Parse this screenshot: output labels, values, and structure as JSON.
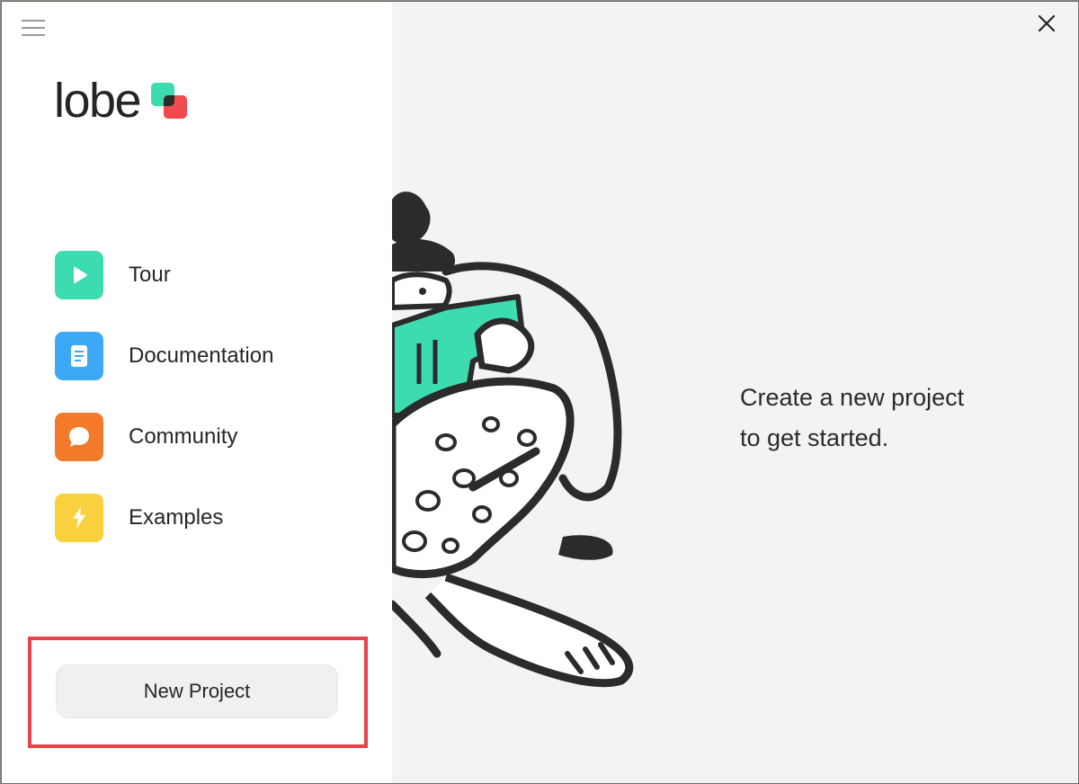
{
  "app": {
    "name": "lobe",
    "brand_colors": {
      "green": "#3ddbb0",
      "red": "#ef4b4f",
      "overlap": "#2b2b2b"
    }
  },
  "sidebar": {
    "menu_icon": "hamburger-icon",
    "items": [
      {
        "label": "Tour",
        "icon": "play-icon",
        "color": "#3ddbb0"
      },
      {
        "label": "Documentation",
        "icon": "document-icon",
        "color": "#3da8f5"
      },
      {
        "label": "Community",
        "icon": "chat-bubble-icon",
        "color": "#f37a2a"
      },
      {
        "label": "Examples",
        "icon": "lightning-icon",
        "color": "#f9d13e"
      }
    ],
    "new_project_label": "New Project"
  },
  "main": {
    "close_icon": "close-icon",
    "prompt_line1": "Create a new project",
    "prompt_line2": "to get started."
  }
}
